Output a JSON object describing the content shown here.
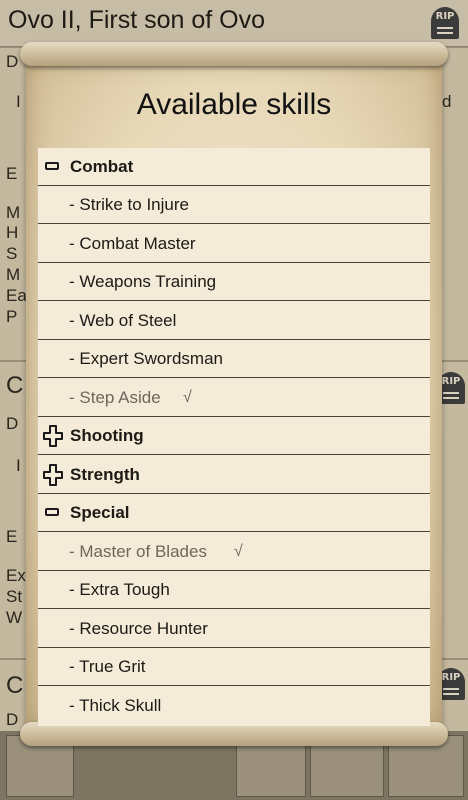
{
  "background": {
    "title": "Ovo II, First son of Ovo",
    "rip_label": "RIP",
    "fragments": [
      "D",
      "I",
      "E",
      "M",
      "H",
      "S",
      "M",
      "Ea",
      "P",
      "C",
      "D",
      "I",
      "E",
      "Ex",
      "St",
      "W",
      "C",
      "D",
      "d"
    ]
  },
  "dialog": {
    "title": "Available skills",
    "groups": [
      {
        "name": "Combat",
        "expanded": true,
        "skills": [
          {
            "label": "- Strike to Injure",
            "taken": false
          },
          {
            "label": "- Combat Master",
            "taken": false
          },
          {
            "label": "- Weapons Training",
            "taken": false
          },
          {
            "label": "- Web of Steel",
            "taken": false
          },
          {
            "label": "- Expert Swordsman",
            "taken": false
          },
          {
            "label": "- Step Aside",
            "taken": true,
            "check": "√"
          }
        ]
      },
      {
        "name": "Shooting",
        "expanded": false,
        "skills": []
      },
      {
        "name": "Strength",
        "expanded": false,
        "skills": []
      },
      {
        "name": "Special",
        "expanded": true,
        "skills": [
          {
            "label": "- Master of Blades",
            "taken": true,
            "check": "√"
          },
          {
            "label": "- Extra Tough",
            "taken": false
          },
          {
            "label": "- Resource Hunter",
            "taken": false
          },
          {
            "label": "- True Grit",
            "taken": false
          },
          {
            "label": "- Thick Skull",
            "taken": false
          }
        ]
      }
    ]
  },
  "colors": {
    "paper": "#f4ecd9",
    "divider": "#4a4438",
    "taken_text": "#6e675c"
  }
}
